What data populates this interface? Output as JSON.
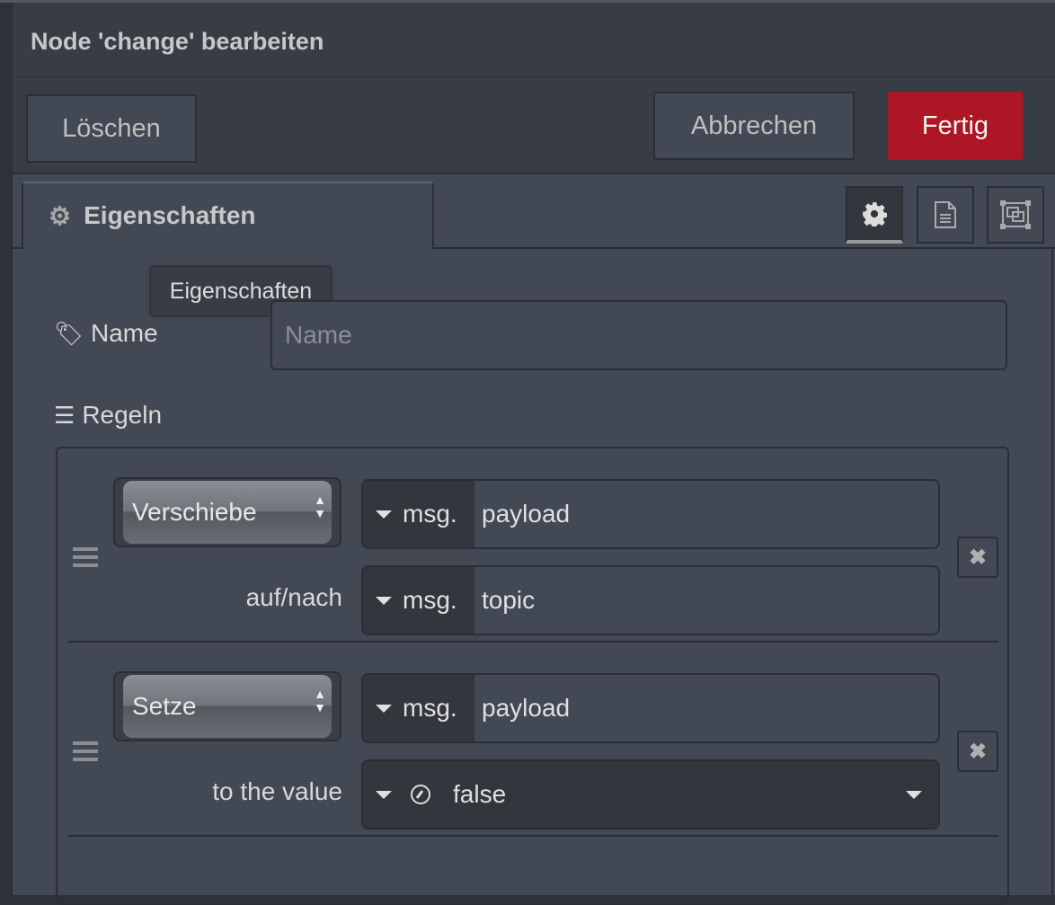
{
  "dialog": {
    "title": "Node 'change' bearbeiten"
  },
  "toolbar": {
    "delete_label": "Löschen",
    "cancel_label": "Abbrechen",
    "done_label": "Fertig"
  },
  "tabs": {
    "properties_label": "Eigenschaften",
    "tooltip": "Eigenschaften",
    "icons": [
      "gear-icon",
      "file-text-icon",
      "frame-icon"
    ]
  },
  "form": {
    "name_label": "Name",
    "name_placeholder": "Name",
    "name_value": "",
    "rules_label": "Regeln"
  },
  "rules": [
    {
      "action": "Verschiebe",
      "target_prefix": "msg.",
      "target": "payload",
      "to_label": "auf/nach",
      "to_prefix": "msg.",
      "to_value": "topic"
    },
    {
      "action": "Setze",
      "target_prefix": "msg.",
      "target": "payload",
      "to_label": "to the value",
      "to_type_icon": "boolean-icon",
      "to_value": "false"
    }
  ],
  "colors": {
    "accent_done": "#ad1625",
    "panel": "#424854",
    "header": "#383c45"
  }
}
